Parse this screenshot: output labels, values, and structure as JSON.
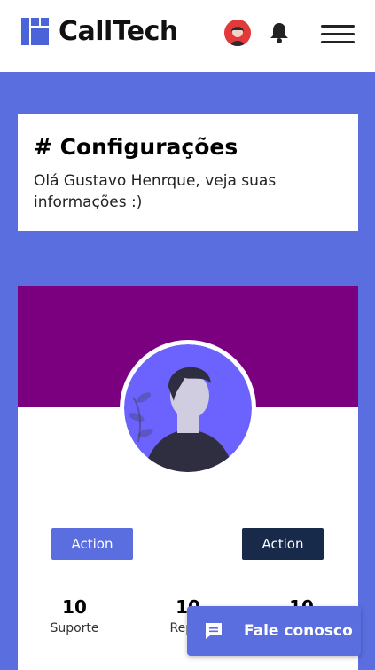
{
  "header": {
    "logo_text": "CallTech",
    "icons": [
      "user-avatar-icon",
      "bell-icon",
      "hamburger-menu-icon"
    ]
  },
  "intro": {
    "title": "# Configurações",
    "greeting": "Olá Gustavo Henrque, veja suas informações :)"
  },
  "profile": {
    "actions": {
      "primary_label": "Action",
      "secondary_label": "Action"
    },
    "stats": [
      {
        "value": "10",
        "label": "Suporte"
      },
      {
        "value": "10",
        "label": "Repor"
      },
      {
        "value": "10",
        "label": ""
      }
    ]
  },
  "contact": {
    "label": "Fale conosco",
    "icon": "chat-icon"
  },
  "colors": {
    "accent": "#5a6ee0",
    "banner": "#7b0080",
    "dark_button": "#182a4a",
    "logo": "#4a63d8"
  }
}
